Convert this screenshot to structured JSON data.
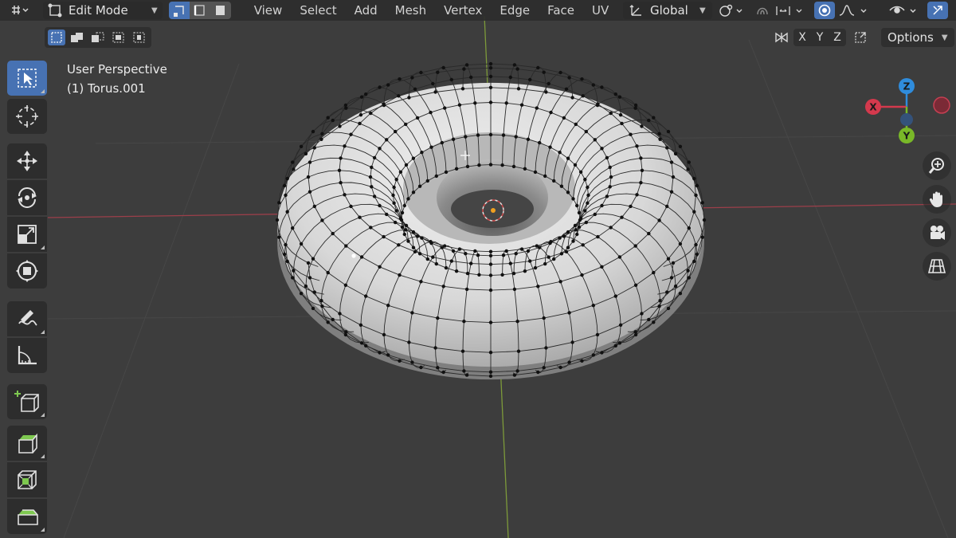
{
  "header": {
    "mode": "Edit Mode",
    "menus": [
      "View",
      "Select",
      "Add",
      "Mesh",
      "Vertex",
      "Edge",
      "Face",
      "UV"
    ],
    "transform_orientation": "Global",
    "select_mode_icons": [
      "vertex-select-icon",
      "edge-select-icon",
      "face-select-icon"
    ]
  },
  "sub_header": {
    "axes": [
      "X",
      "Y",
      "Z"
    ],
    "options_label": "Options"
  },
  "viewport": {
    "view_name": "User Perspective",
    "object_name": "(1) Torus.001"
  },
  "gizmo": {
    "z": "Z",
    "x": "X",
    "y": "Y",
    "colors": {
      "x": "#d4394d",
      "y": "#79b828",
      "z": "#2f8cdc"
    }
  },
  "toolbar": {
    "tools": [
      "select-box-icon",
      "cursor-icon",
      "move-icon",
      "rotate-icon",
      "scale-icon",
      "transform-icon",
      "annotate-icon",
      "measure-icon",
      "add-cube-icon",
      "extrude-icon",
      "inset-icon",
      "bevel-icon"
    ]
  },
  "colors": {
    "accent": "#4772b3",
    "background": "#3d3d3d",
    "panel": "#2d2d2d"
  }
}
